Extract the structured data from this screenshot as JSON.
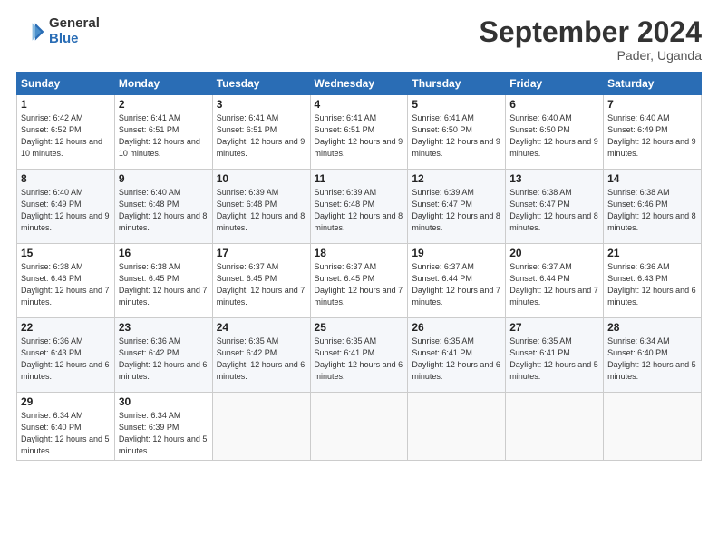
{
  "header": {
    "logo_general": "General",
    "logo_blue": "Blue",
    "month_title": "September 2024",
    "location": "Pader, Uganda"
  },
  "days_of_week": [
    "Sunday",
    "Monday",
    "Tuesday",
    "Wednesday",
    "Thursday",
    "Friday",
    "Saturday"
  ],
  "weeks": [
    [
      {
        "day": "1",
        "sunrise": "6:42 AM",
        "sunset": "6:52 PM",
        "daylight": "12 hours and 10 minutes."
      },
      {
        "day": "2",
        "sunrise": "6:41 AM",
        "sunset": "6:51 PM",
        "daylight": "12 hours and 10 minutes."
      },
      {
        "day": "3",
        "sunrise": "6:41 AM",
        "sunset": "6:51 PM",
        "daylight": "12 hours and 9 minutes."
      },
      {
        "day": "4",
        "sunrise": "6:41 AM",
        "sunset": "6:51 PM",
        "daylight": "12 hours and 9 minutes."
      },
      {
        "day": "5",
        "sunrise": "6:41 AM",
        "sunset": "6:50 PM",
        "daylight": "12 hours and 9 minutes."
      },
      {
        "day": "6",
        "sunrise": "6:40 AM",
        "sunset": "6:50 PM",
        "daylight": "12 hours and 9 minutes."
      },
      {
        "day": "7",
        "sunrise": "6:40 AM",
        "sunset": "6:49 PM",
        "daylight": "12 hours and 9 minutes."
      }
    ],
    [
      {
        "day": "8",
        "sunrise": "6:40 AM",
        "sunset": "6:49 PM",
        "daylight": "12 hours and 9 minutes."
      },
      {
        "day": "9",
        "sunrise": "6:40 AM",
        "sunset": "6:48 PM",
        "daylight": "12 hours and 8 minutes."
      },
      {
        "day": "10",
        "sunrise": "6:39 AM",
        "sunset": "6:48 PM",
        "daylight": "12 hours and 8 minutes."
      },
      {
        "day": "11",
        "sunrise": "6:39 AM",
        "sunset": "6:48 PM",
        "daylight": "12 hours and 8 minutes."
      },
      {
        "day": "12",
        "sunrise": "6:39 AM",
        "sunset": "6:47 PM",
        "daylight": "12 hours and 8 minutes."
      },
      {
        "day": "13",
        "sunrise": "6:38 AM",
        "sunset": "6:47 PM",
        "daylight": "12 hours and 8 minutes."
      },
      {
        "day": "14",
        "sunrise": "6:38 AM",
        "sunset": "6:46 PM",
        "daylight": "12 hours and 8 minutes."
      }
    ],
    [
      {
        "day": "15",
        "sunrise": "6:38 AM",
        "sunset": "6:46 PM",
        "daylight": "12 hours and 7 minutes."
      },
      {
        "day": "16",
        "sunrise": "6:38 AM",
        "sunset": "6:45 PM",
        "daylight": "12 hours and 7 minutes."
      },
      {
        "day": "17",
        "sunrise": "6:37 AM",
        "sunset": "6:45 PM",
        "daylight": "12 hours and 7 minutes."
      },
      {
        "day": "18",
        "sunrise": "6:37 AM",
        "sunset": "6:45 PM",
        "daylight": "12 hours and 7 minutes."
      },
      {
        "day": "19",
        "sunrise": "6:37 AM",
        "sunset": "6:44 PM",
        "daylight": "12 hours and 7 minutes."
      },
      {
        "day": "20",
        "sunrise": "6:37 AM",
        "sunset": "6:44 PM",
        "daylight": "12 hours and 7 minutes."
      },
      {
        "day": "21",
        "sunrise": "6:36 AM",
        "sunset": "6:43 PM",
        "daylight": "12 hours and 6 minutes."
      }
    ],
    [
      {
        "day": "22",
        "sunrise": "6:36 AM",
        "sunset": "6:43 PM",
        "daylight": "12 hours and 6 minutes."
      },
      {
        "day": "23",
        "sunrise": "6:36 AM",
        "sunset": "6:42 PM",
        "daylight": "12 hours and 6 minutes."
      },
      {
        "day": "24",
        "sunrise": "6:35 AM",
        "sunset": "6:42 PM",
        "daylight": "12 hours and 6 minutes."
      },
      {
        "day": "25",
        "sunrise": "6:35 AM",
        "sunset": "6:41 PM",
        "daylight": "12 hours and 6 minutes."
      },
      {
        "day": "26",
        "sunrise": "6:35 AM",
        "sunset": "6:41 PM",
        "daylight": "12 hours and 6 minutes."
      },
      {
        "day": "27",
        "sunrise": "6:35 AM",
        "sunset": "6:41 PM",
        "daylight": "12 hours and 5 minutes."
      },
      {
        "day": "28",
        "sunrise": "6:34 AM",
        "sunset": "6:40 PM",
        "daylight": "12 hours and 5 minutes."
      }
    ],
    [
      {
        "day": "29",
        "sunrise": "6:34 AM",
        "sunset": "6:40 PM",
        "daylight": "12 hours and 5 minutes."
      },
      {
        "day": "30",
        "sunrise": "6:34 AM",
        "sunset": "6:39 PM",
        "daylight": "12 hours and 5 minutes."
      },
      null,
      null,
      null,
      null,
      null
    ]
  ]
}
